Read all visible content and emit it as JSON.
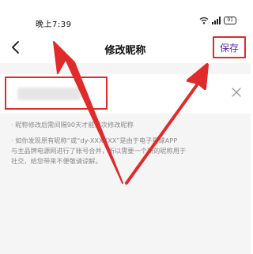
{
  "status_bar": {
    "time": "晚上7:39",
    "battery": "91",
    "icons": [
      "wifi-icon",
      "signal-icon",
      "battery-icon"
    ]
  },
  "header": {
    "title": "修改昵称",
    "save_label": "保存",
    "back_icon": "back-arrow-icon"
  },
  "name_field": {
    "value": "",
    "clear_icon": "close-icon"
  },
  "tips": [
    {
      "lines": [
        "· 昵称修改后需间隔90天才能再次修改昵称"
      ]
    },
    {
      "lines": [
        "· 如你发现原有昵称“或“dy-XXXXXX”是由于电子星球APP",
        "与主品牌电源网进行了账号合并，所以需要一个新的昵称用于",
        "社交，给您带来不便敬请谅解。"
      ]
    }
  ],
  "colors": {
    "accent": "#5b2ca6",
    "annotation": "#e12a2a",
    "background": "#f5f5f5"
  }
}
